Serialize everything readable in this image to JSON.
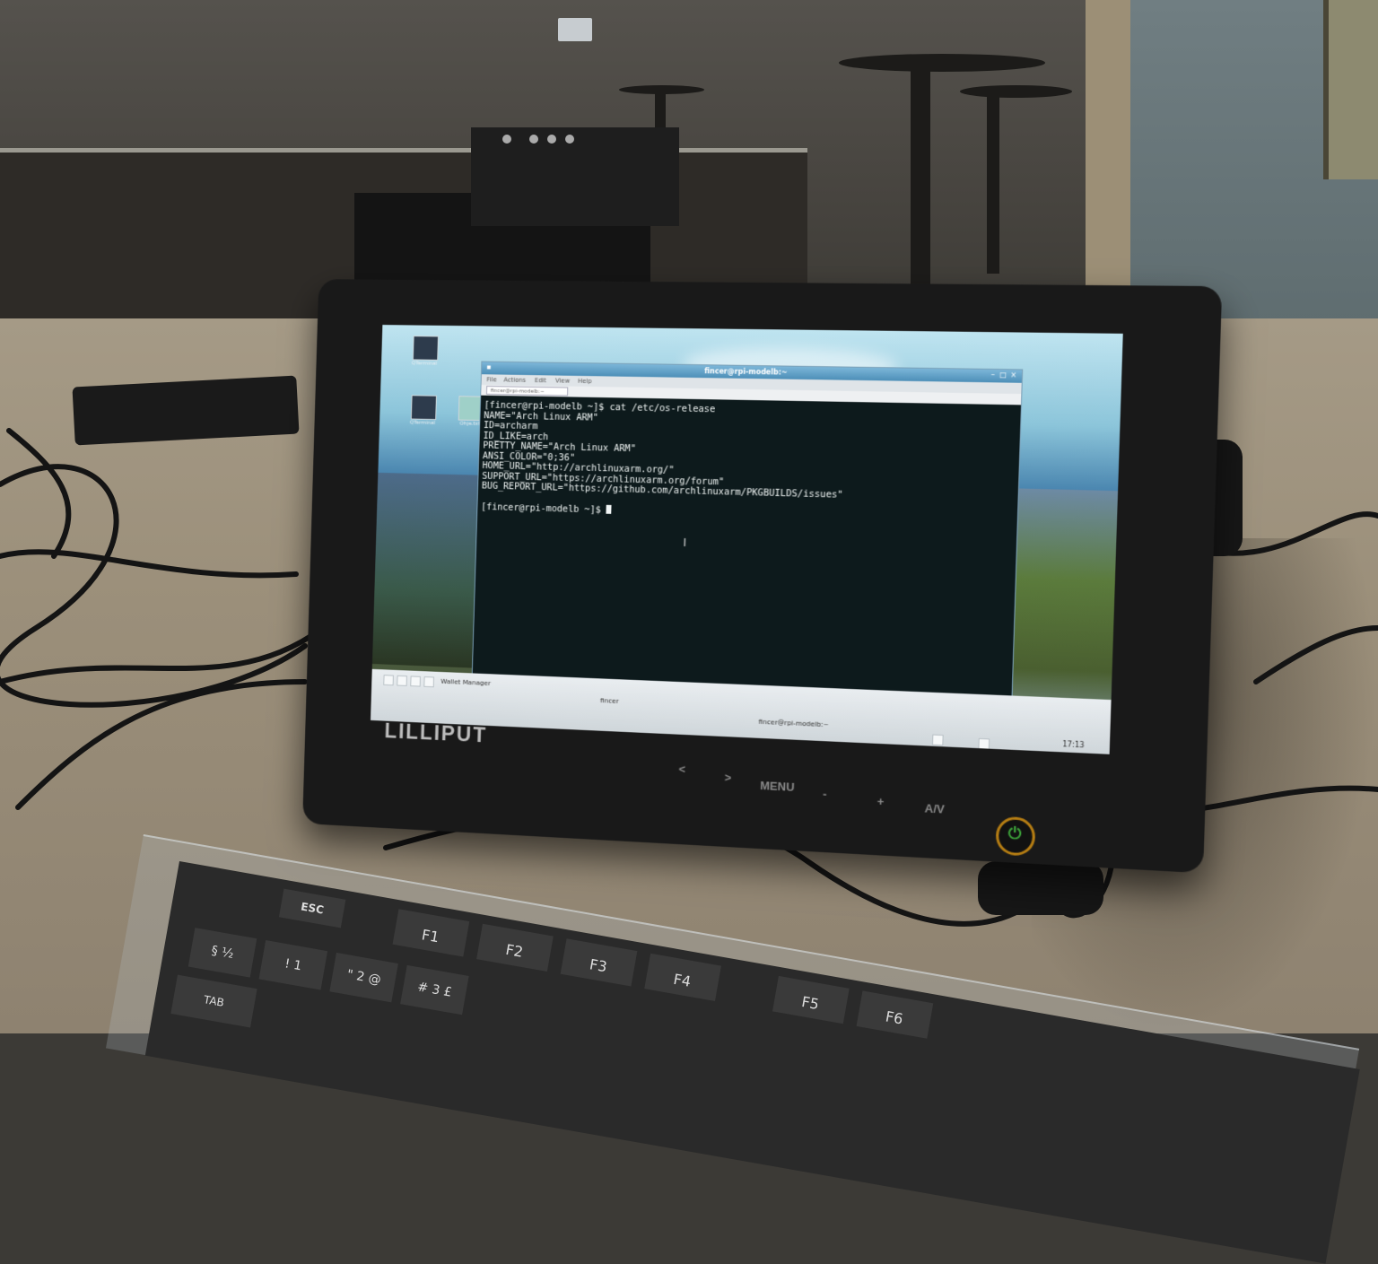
{
  "monitor": {
    "brand": "LILLIPUT",
    "buttons": [
      "<",
      ">",
      "MENU",
      "-",
      "+",
      "A/V"
    ],
    "power_glyph": "⏻"
  },
  "desktop": {
    "icons": [
      {
        "icon": "terminal-icon",
        "label": "QTerminal"
      },
      {
        "icon": "terminal-icon",
        "label": "QTerminal"
      },
      {
        "icon": "text-file-icon",
        "label": "Ohje.txt"
      }
    ]
  },
  "terminal": {
    "title": "fincer@rpi-modelb:~",
    "menu": [
      "File",
      "Actions",
      "Edit",
      "View",
      "Help"
    ],
    "tab_label": "fincer@rpi-modelb:~",
    "lines": [
      "[fincer@rpi-modelb ~]$ cat /etc/os-release",
      "NAME=\"Arch Linux ARM\"",
      "ID=archarm",
      "ID_LIKE=arch",
      "PRETTY_NAME=\"Arch Linux ARM\"",
      "ANSI_COLOR=\"0;36\"",
      "HOME_URL=\"http://archlinuxarm.org/\"",
      "SUPPORT_URL=\"https://archlinuxarm.org/forum\"",
      "BUG_REPORT_URL=\"https://github.com/archlinuxarm/PKGBUILDS/issues\"",
      "",
      "[fincer@rpi-modelb ~]$ "
    ]
  },
  "taskbar": {
    "items": [
      "Wallet Manager",
      "fincer",
      "fincer@rpi-modelb:~"
    ],
    "clock": "17:13"
  },
  "keyboard": {
    "function_keys": [
      "ESC",
      "F1",
      "F2",
      "F3",
      "F4",
      "F5",
      "F6"
    ],
    "number_row": [
      "§ ½",
      "! 1",
      "\" 2 @",
      "# 3 £"
    ],
    "tab": "TAB"
  }
}
